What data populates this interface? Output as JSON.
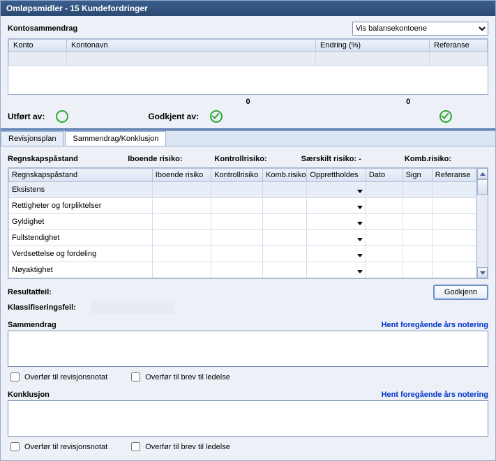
{
  "title": "Omløpsmidler - 15 Kundefordringer",
  "kontosammendrag": {
    "label": "Kontosammendrag",
    "dropdown_selected": "Vis balansekontoene",
    "columns": {
      "konto": "Konto",
      "kontonavn": "Kontonavn",
      "endring": "Endring (%)",
      "referanse": "Referanse"
    },
    "totals": {
      "left": "0",
      "right": "0"
    }
  },
  "status": {
    "utfort_label": "Utført av:",
    "godkjent_label": "Godkjent av:"
  },
  "tabs": {
    "revisjonsplan": "Revisjonsplan",
    "sammendrag": "Sammendrag/Konklusjon"
  },
  "risk": {
    "regnskap": "Regnskapspåstand",
    "iboende": "Iboende risiko:",
    "kontroll": "Kontrollrisiko:",
    "saerskilt": "Særskilt risiko:  -",
    "komb": "Komb.risiko:"
  },
  "inner_headers": {
    "regnskap": "Regnskapspåstand",
    "iboende": "Iboende risiko",
    "kontroll": "Kontrollrisiko",
    "komb": "Komb.risiko",
    "opprettholdes": "Opprettholdes",
    "dato": "Dato",
    "sign": "Sign",
    "referanse": "Referanse"
  },
  "inner_rows": [
    "Eksistens",
    "Rettigheter og forpliktelser",
    "Gyldighet",
    "Fullstendighet",
    "Verdsettelse og fordeling",
    "Nøyaktighet"
  ],
  "result": {
    "resultatfeil": "Resultatfeil:",
    "klassifiseringsfeil": "Klassifiseringsfeil:",
    "godkjenn_btn": "Godkjenn"
  },
  "sammendrag": {
    "title": "Sammendrag",
    "link": "Hent foregående års notering",
    "cb_revnotat": "Overfør til revisjonsnotat",
    "cb_ledelse": "Overfør til brev til ledelse"
  },
  "konklusjon": {
    "title": "Konklusjon",
    "link": "Hent foregående års notering",
    "cb_revnotat": "Overfør til revisjonsnotat",
    "cb_ledelse": "Overfør til brev til ledelse"
  }
}
